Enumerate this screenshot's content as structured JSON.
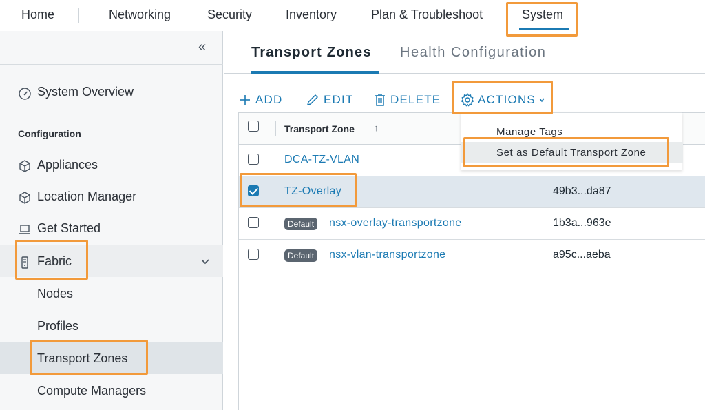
{
  "topnav": {
    "items": [
      "Home",
      "Networking",
      "Security",
      "Inventory",
      "Plan & Troubleshoot",
      "System"
    ],
    "active": "System"
  },
  "sidebar": {
    "collapse_icon": "«",
    "system_overview": "System Overview",
    "section_configuration": "Configuration",
    "appliances": "Appliances",
    "location_manager": "Location Manager",
    "get_started": "Get Started",
    "fabric": "Fabric",
    "fabric_children": [
      "Nodes",
      "Profiles",
      "Transport Zones",
      "Compute Managers"
    ],
    "selected": "Transport Zones"
  },
  "main": {
    "tabs": [
      "Transport Zones",
      "Health Configuration"
    ],
    "active_tab": "Transport Zones",
    "toolbar": {
      "add": "ADD",
      "edit": "EDIT",
      "delete": "DELETE",
      "actions": "ACTIONS"
    },
    "table": {
      "header": "Transport Zone",
      "sort_indicator": "↑",
      "rows": [
        {
          "name": "DCA-TZ-VLAN",
          "id": "",
          "default": false,
          "checked": false
        },
        {
          "name": "TZ-Overlay",
          "id": "49b3...da87",
          "default": false,
          "checked": true
        },
        {
          "name": "nsx-overlay-transportzone",
          "id": "1b3a...963e",
          "default": true,
          "checked": false
        },
        {
          "name": "nsx-vlan-transportzone",
          "id": "a95c...aeba",
          "default": true,
          "checked": false
        }
      ],
      "default_badge": "Default"
    },
    "actions_menu": [
      "Manage Tags",
      "Set as Default Transport Zone"
    ]
  },
  "colors": {
    "accent": "#1b7ab3",
    "highlight": "#f29a3b",
    "badge": "#5b6570"
  }
}
